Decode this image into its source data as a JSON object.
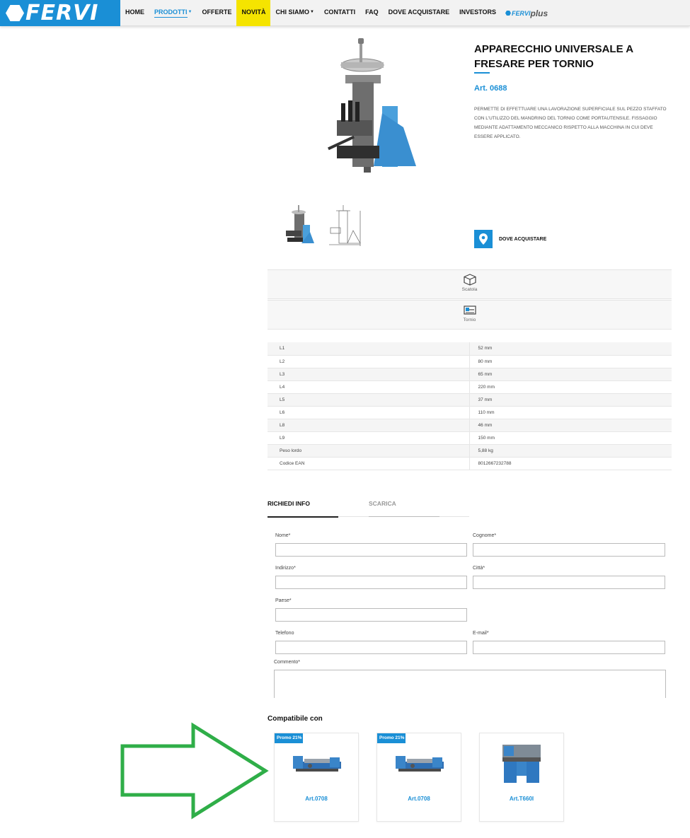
{
  "header": {
    "logo_text": "FERVI",
    "nav": [
      {
        "label": "HOME",
        "dropdown": false
      },
      {
        "label": "PRODOTTI",
        "dropdown": true,
        "active": true
      },
      {
        "label": "OFFERTE",
        "dropdown": false
      },
      {
        "label": "NOVITÀ",
        "dropdown": false,
        "highlight": "#f5e400"
      },
      {
        "label": "CHI SIAMO",
        "dropdown": true
      },
      {
        "label": "CONTATTI",
        "dropdown": false
      },
      {
        "label": "FAQ",
        "dropdown": false
      },
      {
        "label": "DOVE ACQUISTARE",
        "dropdown": false
      },
      {
        "label": "INVESTORS",
        "dropdown": false
      }
    ],
    "plus_logo": {
      "part1": "FERVI",
      "part2": "plus"
    }
  },
  "product": {
    "title": "APPARECCHIO UNIVERSALE A FRESARE PER TORNIO",
    "article": "Art. 0688",
    "description": "PERMETTE DI EFFETTUARE UNA LAVORAZIONE SUPERFICIALE SUL PEZZO STAFFATO CON L'UTILIZZO DEL MANDRINO DEL TORNIO COME PORTAUTENSILE. FISSAGGIO MEDIANTE ADATTAMENTO MECCANICO RISPETTO ALLA MACCHINA IN CUI DEVE ESSERE APPLICATO.",
    "where_to_buy": "DOVE ACQUISTARE"
  },
  "features": [
    {
      "label": "Scatola",
      "icon": "box-icon"
    },
    {
      "label": "Tornio",
      "icon": "lathe-icon"
    }
  ],
  "specs": [
    {
      "key": "L1",
      "value": "52 mm"
    },
    {
      "key": "L2",
      "value": "80 mm"
    },
    {
      "key": "L3",
      "value": "65 mm"
    },
    {
      "key": "L4",
      "value": "220 mm"
    },
    {
      "key": "L5",
      "value": "37 mm"
    },
    {
      "key": "L6",
      "value": "110 mm"
    },
    {
      "key": "L8",
      "value": "46 mm"
    },
    {
      "key": "L9",
      "value": "150 mm"
    },
    {
      "key": "Peso lordo",
      "value": "5,88 kg"
    },
    {
      "key": "Codice EAN",
      "value": "8012667232788"
    }
  ],
  "tabs": {
    "info": "RICHIEDI INFO",
    "download": "SCARICA"
  },
  "form": {
    "nome": "Nome*",
    "cognome": "Cognome*",
    "indirizzo": "Indirizzo*",
    "citta": "Città*",
    "paese": "Paese*",
    "telefono": "Telefono",
    "email": "E-mail*",
    "commento": "Commento*"
  },
  "compatible": {
    "title": "Compatibile con",
    "items": [
      {
        "badge": "Promo 21%",
        "label": "Art.0708"
      },
      {
        "badge": "Promo 21%",
        "label": "Art.0708"
      },
      {
        "badge": "",
        "label": "Art.T660I"
      }
    ]
  },
  "colors": {
    "brand_blue": "#1a8fd6",
    "highlight_yellow": "#f5e400",
    "annotation_arrow": "#2fae48"
  }
}
